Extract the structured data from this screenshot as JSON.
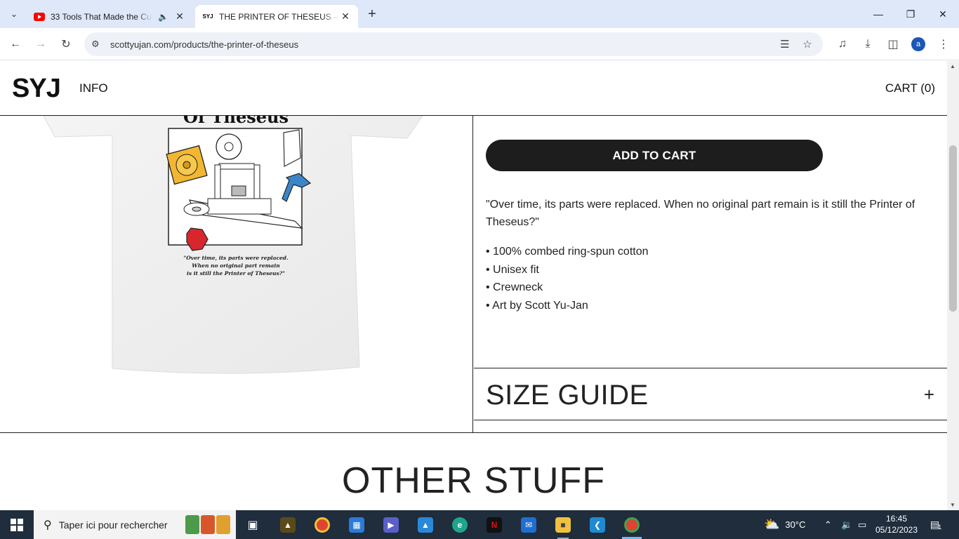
{
  "browser": {
    "tabs": [
      {
        "title": "33 Tools That Made the Cut",
        "favicon": "youtube-icon",
        "audio": true
      },
      {
        "title": "THE PRINTER OF THESEUS – Sc",
        "favicon": "SYJ",
        "active": true
      }
    ],
    "url": "scottyujan.com/products/the-printer-of-theseus",
    "profile_initial": "a"
  },
  "site": {
    "logo": "SYJ",
    "nav_info": "INFO",
    "cart": "CART (0)"
  },
  "product": {
    "art_title_partial": "Of Theseus",
    "art_caption": "\"Over time, its parts were replaced. When no original part remain is it still the Printer of Theseus?\"",
    "add_to_cart": "ADD TO CART",
    "description": "\"Over time, its parts were replaced. When no original part remain is it still the Printer of Theseus?\"",
    "bullets": [
      "• 100% combed ring-spun cotton",
      "• Unisex fit",
      "• Crewneck",
      "• Art by Scott Yu-Jan"
    ],
    "size_guide": "SIZE GUIDE",
    "size_guide_toggle": "+"
  },
  "section": {
    "other_stuff": "OTHER STUFF"
  },
  "taskbar": {
    "search_placeholder": "Taper ici pour rechercher",
    "weather": "30°C",
    "time": "16:45",
    "date": "05/12/2023",
    "notifications": "1"
  },
  "colors": {
    "tabstrip": "#dee8f8",
    "button": "#1d1d1d",
    "taskbar": "#1f2d3d"
  }
}
